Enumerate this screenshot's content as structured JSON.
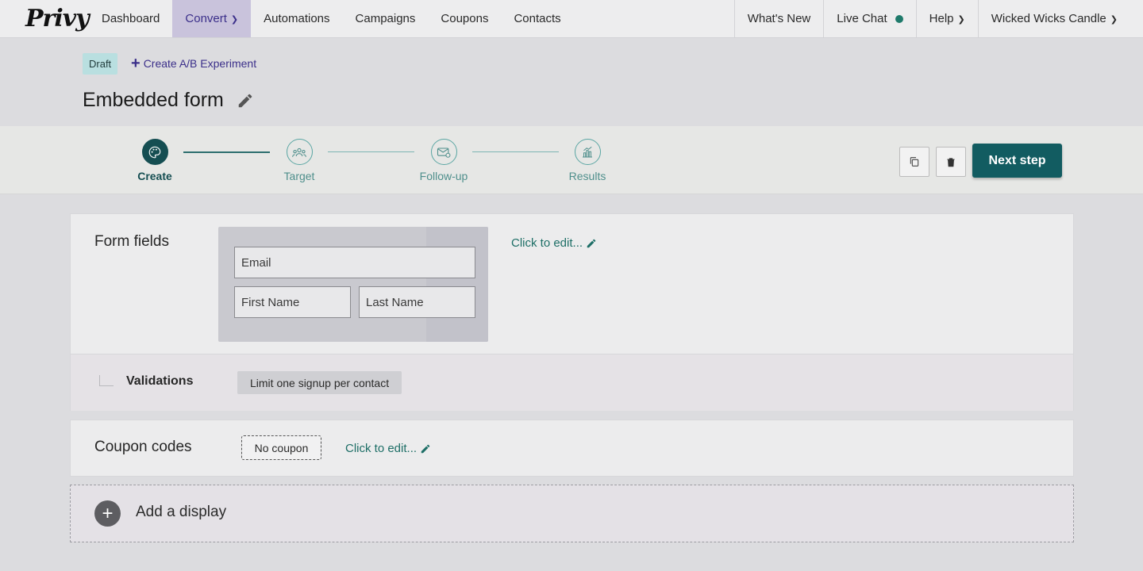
{
  "nav": {
    "logo": "Privy",
    "items": [
      "Dashboard",
      "Convert",
      "Automations",
      "Campaigns",
      "Coupons",
      "Contacts"
    ],
    "right": {
      "whats_new": "What's New",
      "live_chat": "Live Chat",
      "help": "Help",
      "account": "Wicked Wicks Candle"
    },
    "colors": {
      "active_bg": "#c9c3dc",
      "live_dot": "#1f7a6b"
    }
  },
  "header": {
    "status_badge": "Draft",
    "ab_link": "Create A/B Experiment",
    "title": "Embedded form"
  },
  "steps": [
    {
      "label": "Create",
      "icon": "palette-icon",
      "active": true
    },
    {
      "label": "Target",
      "icon": "audience-icon",
      "active": false
    },
    {
      "label": "Follow-up",
      "icon": "mail-icon",
      "active": false
    },
    {
      "label": "Results",
      "icon": "chart-icon",
      "active": false
    }
  ],
  "actions": {
    "next_step": "Next step",
    "copy_icon": "copy-icon",
    "delete_icon": "trash-icon",
    "accent": "#125c61"
  },
  "form_fields": {
    "title": "Form fields",
    "placeholders": {
      "email": "Email",
      "first_name": "First Name",
      "last_name": "Last Name"
    },
    "edit_link": "Click to edit...",
    "validations": {
      "label": "Validations",
      "rule": "Limit one signup per contact"
    }
  },
  "coupon": {
    "title": "Coupon codes",
    "value": "No coupon",
    "edit_link": "Click to edit..."
  },
  "add_display": {
    "label": "Add a display"
  }
}
